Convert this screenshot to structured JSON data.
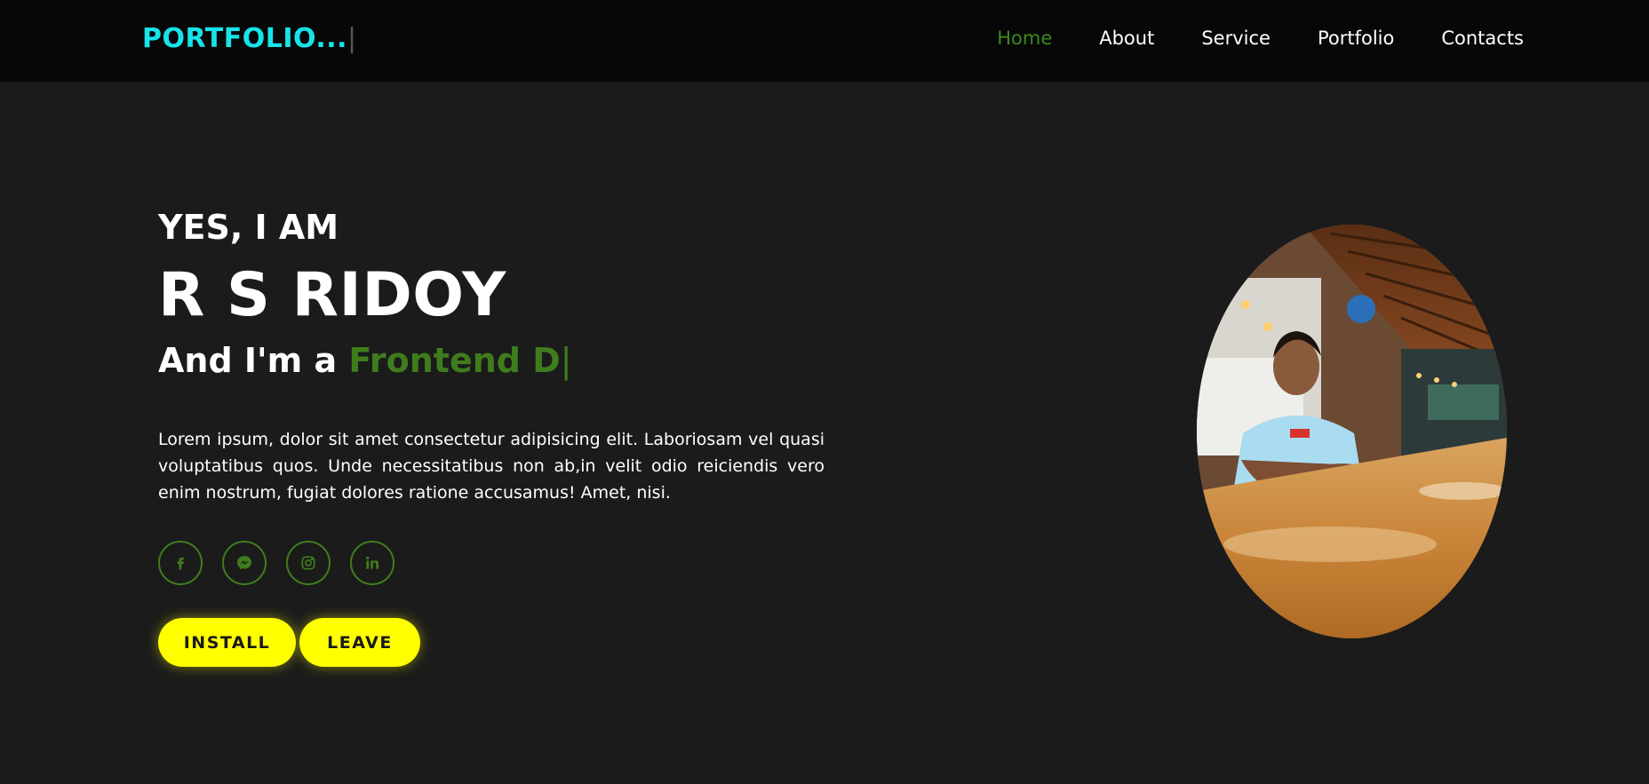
{
  "nav": {
    "logo": "PORTFOLIO...",
    "logo_caret": "|",
    "links": [
      {
        "label": "Home",
        "active": true
      },
      {
        "label": "About",
        "active": false
      },
      {
        "label": "Service",
        "active": false
      },
      {
        "label": "Portfolio",
        "active": false
      },
      {
        "label": "Contacts",
        "active": false
      }
    ]
  },
  "hero": {
    "greeting": "YES, I AM",
    "name": "R S RIDOY",
    "role_prefix": "And I'm a ",
    "role_typed": "Frontend D",
    "role_cursor": "|",
    "bio": "Lorem ipsum, dolor sit amet consectetur adipisicing elit. Laboriosam vel quasi voluptatibus quos. Unde necessitatibus non ab,in velit odio reiciendis vero enim nostrum, fugiat dolores ratione accusamus! Amet, nisi.",
    "socials": [
      {
        "icon": "facebook-icon"
      },
      {
        "icon": "messenger-icon"
      },
      {
        "icon": "instagram-icon"
      },
      {
        "icon": "linkedin-icon"
      }
    ],
    "buttons": {
      "install_label": "INSTALL",
      "leave_label": "LEAVE"
    }
  },
  "colors": {
    "accent_green": "#3f7d1c",
    "logo_cyan": "#16e4ea",
    "button_yellow": "#ffff00",
    "background": "#1b1b1b",
    "navbar": "#070707"
  }
}
